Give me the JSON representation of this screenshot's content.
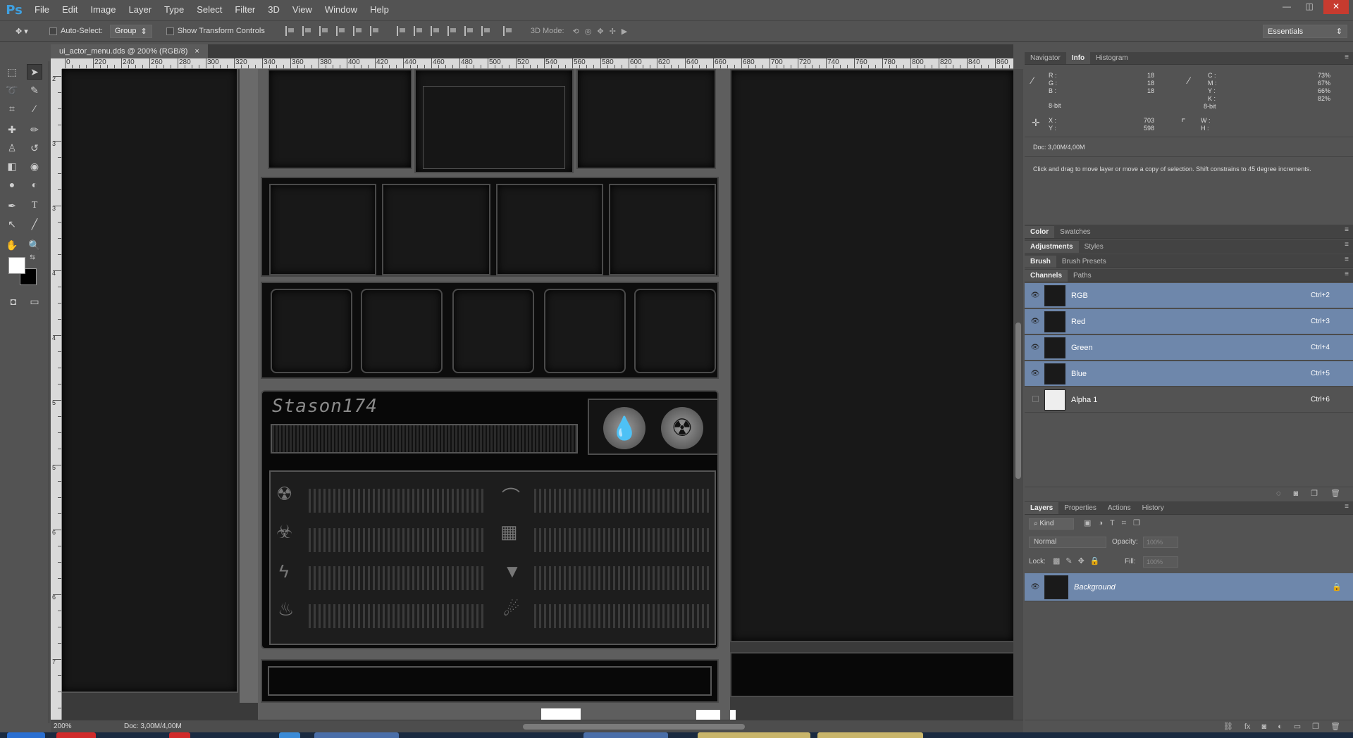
{
  "app": {
    "logo": "Ps"
  },
  "menu": [
    "File",
    "Edit",
    "Image",
    "Layer",
    "Type",
    "Select",
    "Filter",
    "3D",
    "View",
    "Window",
    "Help"
  ],
  "window_controls": [
    "—",
    "◫",
    "✕"
  ],
  "options": {
    "auto_select_label": "Auto-Select:",
    "auto_select_value": "Group",
    "show_transform": "Show Transform Controls",
    "mode_3d": "3D Mode:",
    "workspace": "Essentials"
  },
  "document": {
    "tab_title": "ui_actor_menu.dds @ 200% (RGB/8)",
    "tab_close": "×",
    "zoom": "200%",
    "doc_size": "Doc: 3,00M/4,00M"
  },
  "ruler_h": [
    "0",
    "220",
    "240",
    "260",
    "280",
    "300",
    "320",
    "340",
    "360",
    "380",
    "400",
    "420",
    "440",
    "460",
    "480",
    "500",
    "520",
    "540",
    "560",
    "580",
    "600",
    "620",
    "640",
    "660",
    "680",
    "700",
    "720",
    "740",
    "760",
    "780",
    "800",
    "820",
    "840",
    "860"
  ],
  "ruler_v": [
    "2",
    "3",
    "3",
    "4",
    "4",
    "5",
    "5",
    "6",
    "6",
    "7"
  ],
  "canvas": {
    "player_name": "Stason174"
  },
  "info_panel": {
    "tabs": [
      "Navigator",
      "Info",
      "Histogram"
    ],
    "r_label": "R :",
    "g_label": "G :",
    "b_label": "B :",
    "r": "18",
    "g": "18",
    "b": "18",
    "c_label": "C :",
    "m_label": "M :",
    "y_label": "Y :",
    "k_label": "K :",
    "c": "73%",
    "m": "67%",
    "y": "66%",
    "k": "82%",
    "bit_left": "8-bit",
    "bit_right": "8-bit",
    "x_label": "X :",
    "y2_label": "Y :",
    "x": "703",
    "y2": "598",
    "w_label": "W :",
    "h_label": "H :",
    "doc": "Doc: 3,00M/4,00M",
    "hint": "Click and drag to move layer or move a copy of selection. Shift constrains to 45 degree increments."
  },
  "panel_tabs": {
    "color": [
      "Color",
      "Swatches"
    ],
    "adjust": [
      "Adjustments",
      "Styles"
    ],
    "brush": [
      "Brush",
      "Brush Presets"
    ],
    "channels": [
      "Channels",
      "Paths"
    ],
    "layers": [
      "Layers",
      "Properties",
      "Actions",
      "History"
    ]
  },
  "channels": [
    {
      "name": "RGB",
      "shortcut": "Ctrl+2",
      "selected": true
    },
    {
      "name": "Red",
      "shortcut": "Ctrl+3",
      "selected": true
    },
    {
      "name": "Green",
      "shortcut": "Ctrl+4",
      "selected": true
    },
    {
      "name": "Blue",
      "shortcut": "Ctrl+5",
      "selected": true
    },
    {
      "name": "Alpha 1",
      "shortcut": "Ctrl+6",
      "selected": false
    }
  ],
  "layers": {
    "kind": "Kind",
    "blend": "Normal",
    "opacity_label": "Opacity:",
    "opacity": "100%",
    "lock_label": "Lock:",
    "fill_label": "Fill:",
    "fill": "100%",
    "items": [
      {
        "name": "Background"
      }
    ]
  },
  "colors": {
    "accent": "#3fa0e0",
    "selection": "#6e87ab",
    "panel": "#535353"
  }
}
